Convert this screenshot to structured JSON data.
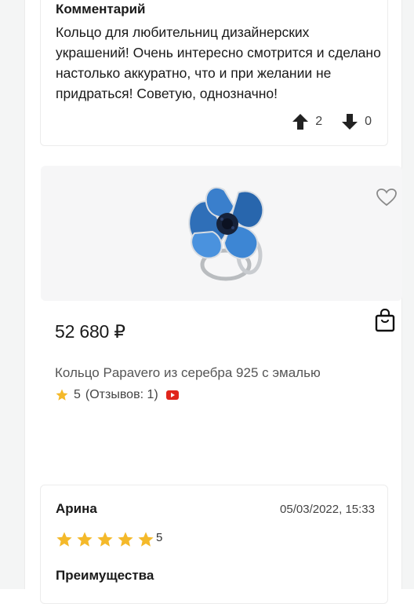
{
  "review_top": {
    "title": "Комментарий",
    "text": "Кольцо для любительниц дизайнерских украшений! Очень интересно смотрится и сделано настолько аккуратно, что и при желании не придраться! Советую, однозначно!",
    "upvotes": "2",
    "downvotes": "0"
  },
  "product": {
    "price": "52 680 ₽",
    "name": "Кольцо Papavero из серебра 925 с эмалью",
    "rating": "5",
    "reviews_label": "(Отзывов: 1)",
    "icons": {
      "favorite": "heart-outline-icon",
      "cart": "shopping-bag-icon",
      "video": "youtube-icon"
    }
  },
  "review_bottom": {
    "author": "Арина",
    "date": "05/03/2022, 15:33",
    "stars": 5,
    "stars_label": "5",
    "advantages_title": "Преимущества"
  },
  "colors": {
    "star": "#f4b92a",
    "youtube": "#e0251b",
    "image_bg": "#f6f6f7"
  }
}
